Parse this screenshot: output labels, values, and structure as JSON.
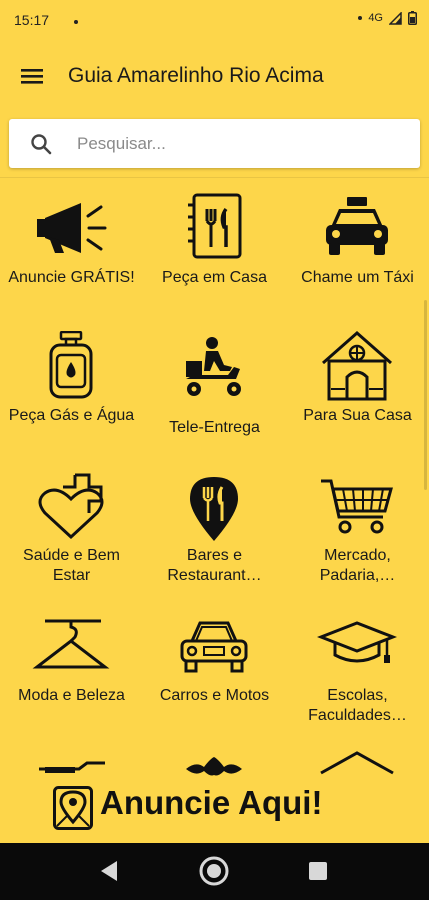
{
  "status": {
    "time": "15:17",
    "network": "4G"
  },
  "app": {
    "title": "Guia Amarelinho Rio Acima"
  },
  "search": {
    "placeholder": "Pesquisar..."
  },
  "categories": [
    {
      "label": "Anuncie GRÁTIS!",
      "icon": "megaphone-icon"
    },
    {
      "label": "Peça em Casa",
      "icon": "menu-book-icon"
    },
    {
      "label": "Chame um Táxi",
      "icon": "taxi-icon"
    },
    {
      "label": "Peça Gás e Água",
      "icon": "gas-cylinder-icon"
    },
    {
      "label": "Tele-Entrega",
      "icon": "delivery-scooter-icon"
    },
    {
      "label": "Para Sua Casa",
      "icon": "house-icon"
    },
    {
      "label": "Saúde e Bem Estar",
      "icon": "health-heart-icon"
    },
    {
      "label": "Bares e Restaurant…",
      "icon": "restaurant-pin-icon"
    },
    {
      "label": "Mercado, Padaria,…",
      "icon": "shopping-cart-icon"
    },
    {
      "label": "Moda e Beleza",
      "icon": "hanger-icon"
    },
    {
      "label": "Carros e Motos",
      "icon": "car-icon"
    },
    {
      "label": "Escolas, Faculdades…",
      "icon": "graduation-cap-icon"
    }
  ],
  "banner": {
    "text": "Anuncie Aqui!",
    "icon": "map-pin-icon"
  },
  "colors": {
    "background": "#FDD64A",
    "nav": "#0a0a0a",
    "ink": "#111111"
  }
}
